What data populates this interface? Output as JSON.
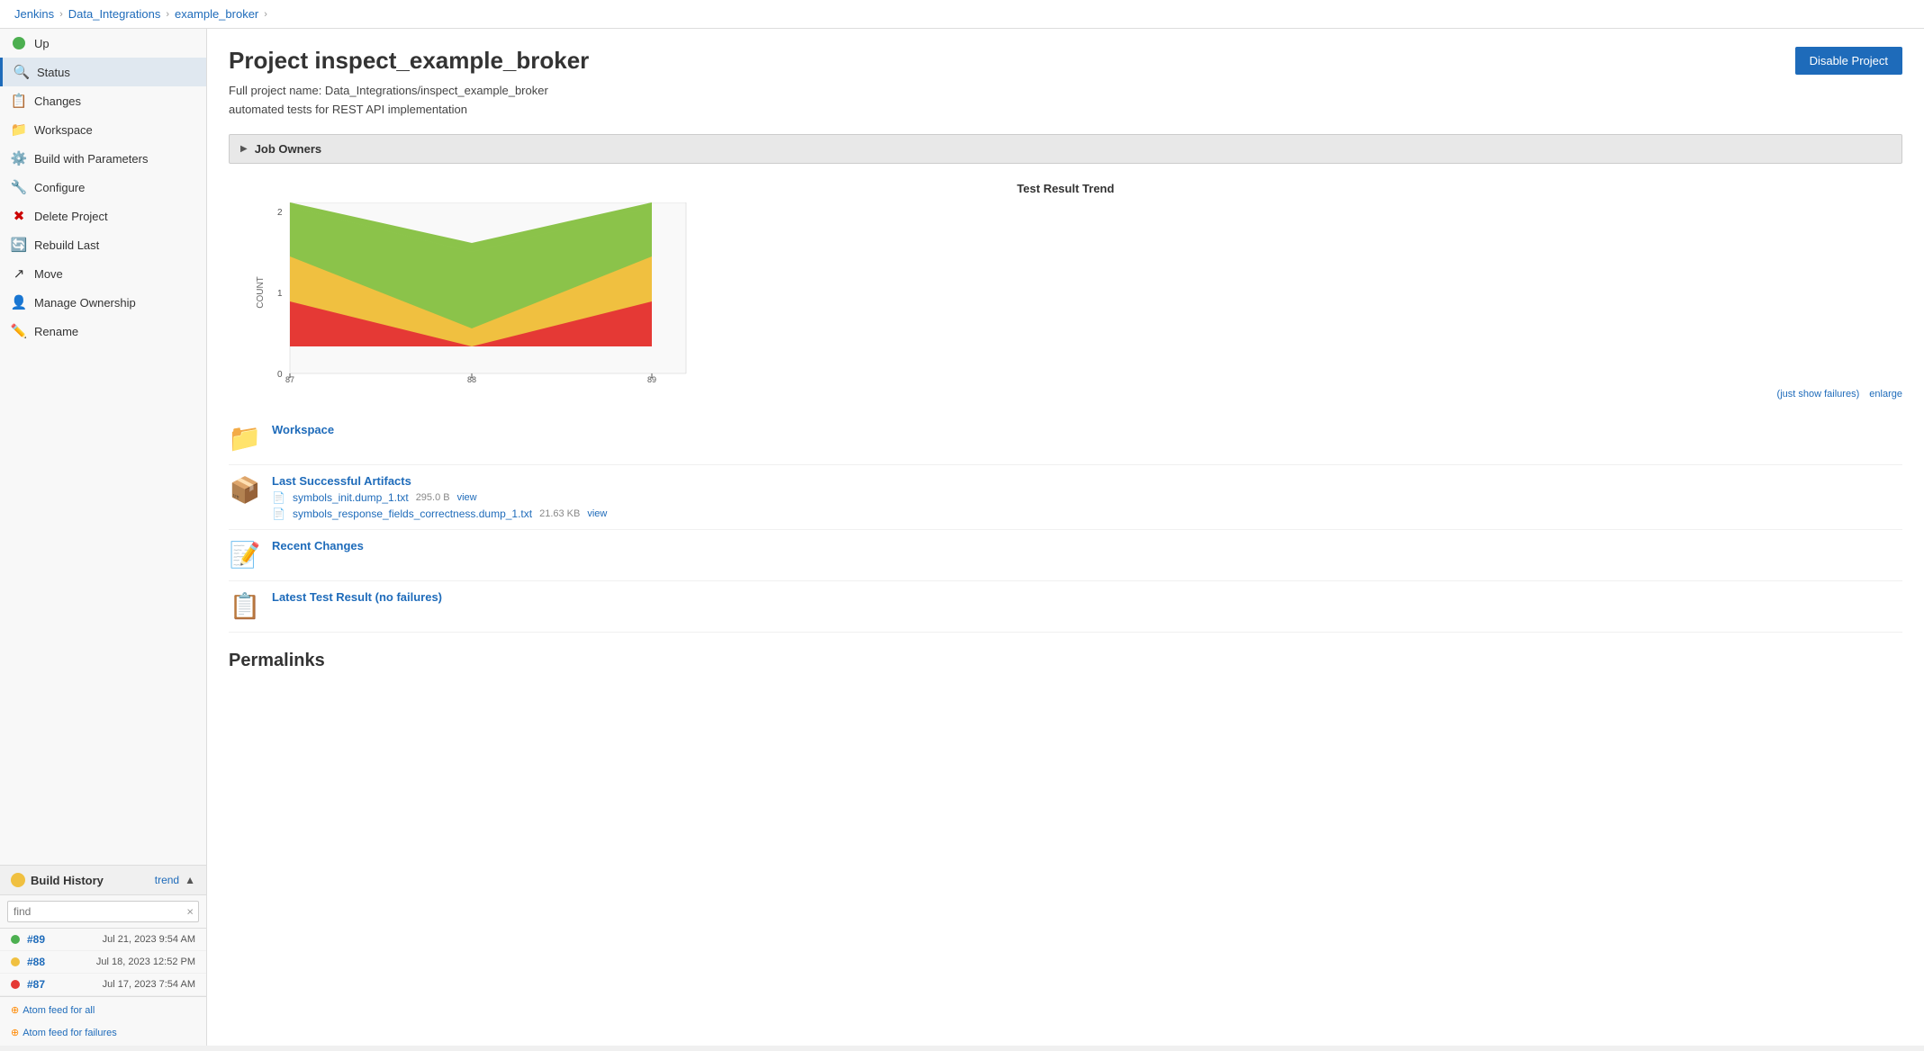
{
  "breadcrumb": {
    "items": [
      "Jenkins",
      "Data_Integrations",
      "example_broker"
    ],
    "separators": [
      "›",
      "›",
      "›"
    ]
  },
  "sidebar": {
    "nav_items": [
      {
        "id": "up",
        "label": "Up",
        "icon": "up-icon",
        "active": false,
        "has_green_dot": true
      },
      {
        "id": "status",
        "label": "Status",
        "icon": "search-icon",
        "active": true
      },
      {
        "id": "changes",
        "label": "Changes",
        "icon": "changes-icon",
        "active": false
      },
      {
        "id": "workspace",
        "label": "Workspace",
        "icon": "workspace-icon",
        "active": false
      },
      {
        "id": "build-with-parameters",
        "label": "Build with Parameters",
        "icon": "build-icon",
        "active": false
      },
      {
        "id": "configure",
        "label": "Configure",
        "icon": "gear-icon",
        "active": false
      },
      {
        "id": "delete-project",
        "label": "Delete Project",
        "icon": "delete-icon",
        "active": false
      },
      {
        "id": "rebuild-last",
        "label": "Rebuild Last",
        "icon": "rebuild-icon",
        "active": false
      },
      {
        "id": "move",
        "label": "Move",
        "icon": "move-icon",
        "active": false
      },
      {
        "id": "manage-ownership",
        "label": "Manage Ownership",
        "icon": "manage-icon",
        "active": false
      },
      {
        "id": "rename",
        "label": "Rename",
        "icon": "rename-icon",
        "active": false
      }
    ]
  },
  "build_history": {
    "title": "Build History",
    "trend_label": "trend",
    "search_placeholder": "find",
    "search_clear": "×",
    "builds": [
      {
        "number": "#89",
        "date": "Jul 21, 2023 9:54 AM",
        "status": "green"
      },
      {
        "number": "#88",
        "date": "Jul 18, 2023 12:52 PM",
        "status": "yellow"
      },
      {
        "number": "#87",
        "date": "Jul 17, 2023 7:54 AM",
        "status": "red"
      }
    ],
    "atom_feeds": [
      {
        "label": "Atom feed for all",
        "id": "atom-all"
      },
      {
        "label": "Atom feed for failures",
        "id": "atom-failures"
      }
    ]
  },
  "main": {
    "title": "Project inspect_example_broker",
    "full_project_name_label": "Full project name: Data_Integrations/inspect_example_broker",
    "description": "automated tests for REST API implementation",
    "job_owners_label": "Job Owners",
    "disable_btn_label": "Disable Project",
    "test_result_trend_title": "Test Result Trend",
    "chart_links": {
      "show_failures": "(just show failures)",
      "enlarge": "enlarge"
    },
    "workspace_label": "Workspace",
    "last_successful_artifacts_label": "Last Successful Artifacts",
    "artifacts": [
      {
        "name": "symbols_init.dump_1.txt",
        "size": "295.0 B",
        "view_label": "view"
      },
      {
        "name": "symbols_response_fields_correctness.dump_1.txt",
        "size": "21.63 KB",
        "view_label": "view"
      }
    ],
    "recent_changes_label": "Recent Changes",
    "latest_test_result_label": "Latest Test Result (no failures)",
    "permalinks_title": "Permalinks"
  },
  "chart": {
    "y_label": "COUNT",
    "y_max": 2,
    "y_min": 0,
    "colors": {
      "pass": "#8bc34a",
      "skip": "#f0c040",
      "fail": "#e53935"
    }
  }
}
